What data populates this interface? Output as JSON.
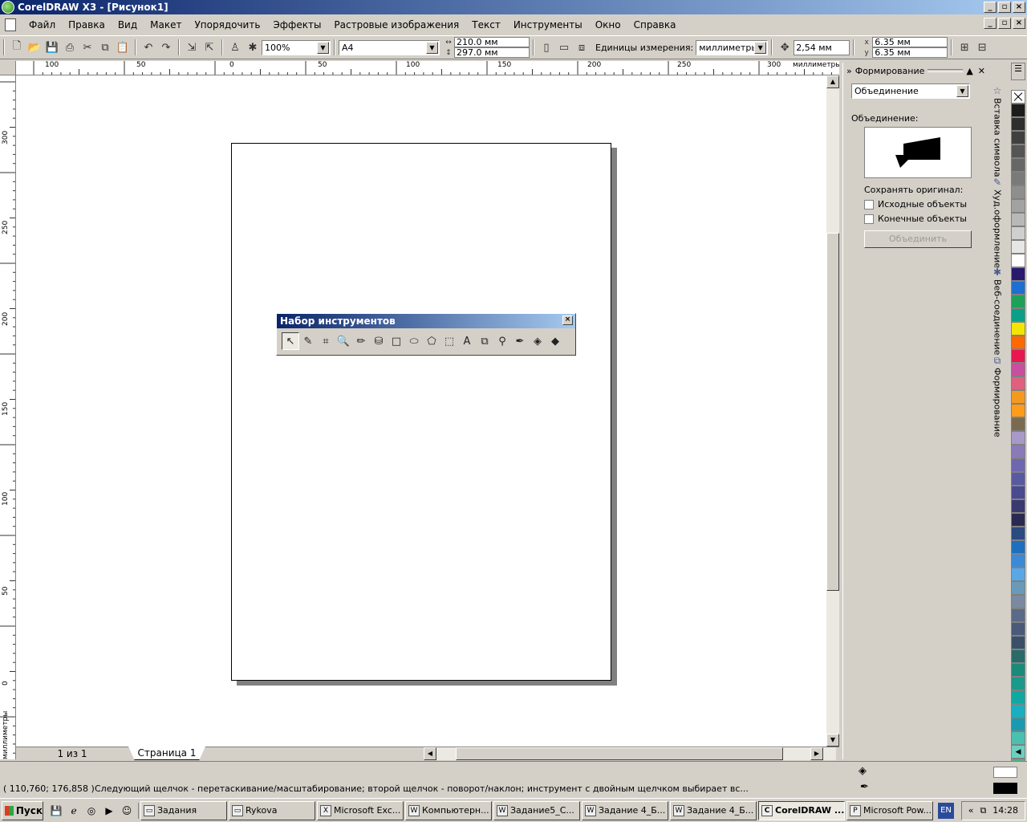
{
  "titlebar": {
    "title": "CorelDRAW X3 - [Рисунок1]",
    "buttons": [
      "_",
      "▫",
      "×"
    ]
  },
  "menu": {
    "items": [
      "Файл",
      "Правка",
      "Вид",
      "Макет",
      "Упорядочить",
      "Эффекты",
      "Растровые изображения",
      "Текст",
      "Инструменты",
      "Окно",
      "Справка"
    ]
  },
  "propbar": {
    "zoom": "100%",
    "paper": "A4",
    "width": "210.0 мм",
    "height": "297.0 мм",
    "units_label": "Единицы измерения:",
    "units_value": "миллиметры",
    "nudge": "2,54 мм",
    "dup_x": "6.35 мм",
    "dup_y": "6.35 мм"
  },
  "ruler": {
    "h_labels": [
      "100",
      "50",
      "0",
      "50",
      "100",
      "150",
      "200",
      "250",
      "300",
      "миллиметры"
    ],
    "v_labels": [
      "300",
      "250",
      "200",
      "150",
      "100",
      "50",
      "0",
      "миллиметры"
    ]
  },
  "toolbox": {
    "title": "Набор инструментов"
  },
  "pages": {
    "count": "1 из 1",
    "tab": "Страница 1"
  },
  "docker": {
    "title": "Формирование",
    "mode": "Объединение",
    "section_label": "Объединение:",
    "keep_label": "Сохранять оригинал:",
    "source_label": "Исходные объекты",
    "target_label": "Конечные объекты",
    "apply_button": "Объединить"
  },
  "docker_tabs": [
    "Вставка символа",
    "Худ.оформление",
    "Веб-соединение",
    "Формирование"
  ],
  "palette": [
    "#1c1c1c",
    "#2e2e2e",
    "#404040",
    "#555555",
    "#676767",
    "#7a7a7a",
    "#8e8e8e",
    "#a2a2a2",
    "#b8b8b8",
    "#cfcfcf",
    "#e6e6e6",
    "#ffffff",
    "#2a1a6e",
    "#1e6fd0",
    "#1fa05a",
    "#0aa088",
    "#f2e600",
    "#ff6a00",
    "#e8174f",
    "#c84fa0",
    "#e06080",
    "#f39a1e",
    "#ff9c1a",
    "#7a6a50",
    "#a899c9",
    "#8a7ab8",
    "#6e67b0",
    "#5a5aa0",
    "#4a4a90",
    "#3a3a70",
    "#2a2a50",
    "#2a4a80",
    "#1e6fc0",
    "#3a8ad8",
    "#58a8e8",
    "#6a9ab8",
    "#7a8aa0",
    "#5a6a88",
    "#4a5a78",
    "#3a5068",
    "#2a6a6a",
    "#1a8a7a",
    "#1a9a8a",
    "#10a8a0",
    "#18b0c0",
    "#1a9ab0",
    "#4ac0b0",
    "#6ad0c0",
    "#5ab08a",
    "#4a9a6a"
  ],
  "status": {
    "coords": "( 110,760; 176,858 )",
    "hint": "Следующий щелчок - перетаскивание/масштабирование; второй щелчок - поворот/наклон; инструмент с двойным щелчком выбирает вс..."
  },
  "taskbar": {
    "start": "Пуск",
    "tasks": [
      "Задания",
      "Rykova",
      "Microsoft Exc...",
      "Компьютерн...",
      "Задание5_С...",
      "Задание 4_Б...",
      "Задание 4_Б...",
      "CorelDRAW ...",
      "Microsoft Pow..."
    ],
    "lang": "EN",
    "clock": "14:28"
  }
}
